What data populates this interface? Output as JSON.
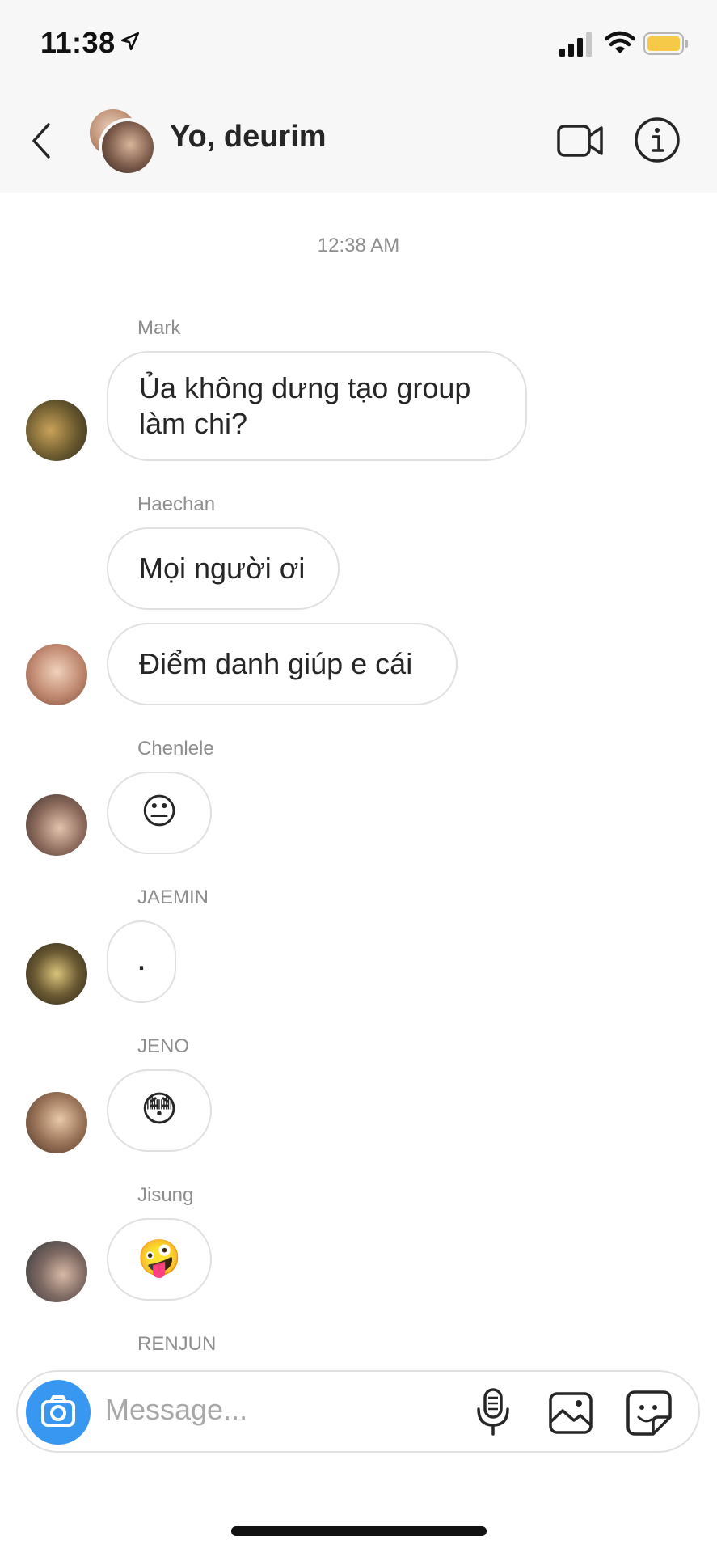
{
  "status": {
    "time": "11:38"
  },
  "header": {
    "title": "Yo, deurim"
  },
  "thread": {
    "timestamp": "12:38 AM",
    "messages": [
      {
        "sender": "Mark",
        "lines": [
          "Ủa không dưng tạo group",
          "làm chi?"
        ]
      },
      {
        "sender": "Haechan",
        "lines": [
          "Mọi người ơi"
        ]
      },
      {
        "sender": "",
        "lines": [
          "Điểm danh giúp e cái"
        ]
      },
      {
        "sender": "Chenlele",
        "lines": [
          "😐"
        ]
      },
      {
        "sender": "JAEMIN",
        "lines": [
          "."
        ]
      },
      {
        "sender": "JENO",
        "lines": [
          "😳"
        ]
      },
      {
        "sender": "Jisung",
        "lines": [
          "🤪"
        ]
      },
      {
        "sender": "RENJUN",
        "lines": []
      }
    ]
  },
  "composer": {
    "placeholder": "Message..."
  },
  "colors": {
    "accent": "#3897f0",
    "battery": "#f7c948"
  }
}
